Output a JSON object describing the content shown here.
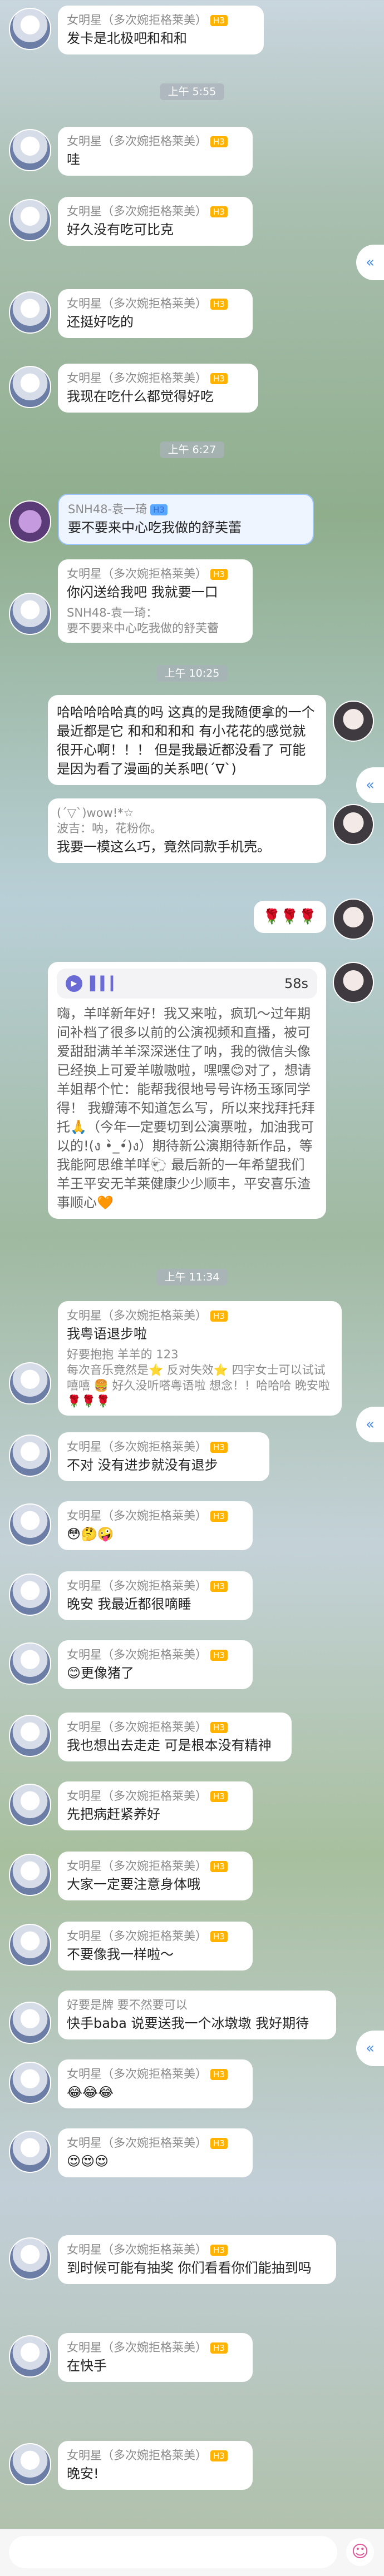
{
  "name_main": "女明星（多次婉拒格莱美）",
  "tag_main": "H3",
  "name_snh": "SNH48-袁一琦",
  "tag_snh": "H3",
  "collapse_glyph": "«",
  "times": [
    "上午 5:55",
    "上午 6:27",
    "上午 10:25",
    "上午 11:34"
  ],
  "messages": {
    "m1": "发卡是北极吧和和和",
    "m2": "哇",
    "m3": "好久没有吃可比克",
    "m4": "还挺好吃的",
    "m5": "我现在吃什么都觉得好吃",
    "snh_text": "要不要来中心吃我做的舒芙蕾",
    "m6_text": "你闪送给我吧 我就要一口",
    "m6_quote": "SNH48-袁一琦：\n要不要来中心吃我做的舒芙蕾",
    "self1": "哈哈哈哈哈真的吗 这真的是我随便拿的一个 最近都是它 和和和和和 有小花花的感觉就很开心啊！！！ 但是我最近都没看了 可能是因为看了漫画的关系吧(´∇`)",
    "self2_text": "我要一模这么巧，竟然同款手机壳。",
    "self2_quote": "(´▽`)wow!*☆\n波吉：呐，花粉你。",
    "self3_emoji": "🌹🌹🌹",
    "voice_duration": "58s",
    "self4_text": "嗨，羊咩新年好！我又来啦，疯玑～过年期间补档了很多以前的公演视频和直播，被可爱甜甜满羊羊深深迷住了呐，我的微信头像已经换上可爱羊嗷嗷啦，嘿嘿😊对了，想请羊姐帮个忙：能帮我很地号号许杨玉琢同学得！ 我瓣薄不知道怎么写，所以来找拜托拜托🙏（今年一定要切到公演票啦，加油我可以的!(ง •̀_•́)ง）期待新公演期待新作品，等我能阿思维羊咩🐑 最后新的一年希望我们羊王平安无羊莱健康少少顺丰，平安喜乐渣事顺心🧡",
    "m7_text": "我粤语退步啦",
    "m7_quote": "好要抱抱 羊羊的 123\n每次音乐竟然是⭐️ 反对失效⭐️ 四字女士可以试试嘻嘻 🍔 好久没听嗒粤语啦 想念！！哈哈哈 晚安啦🌹🌹🌹",
    "m8": "不对 没有进步就没有退步",
    "m9": "😳🤔🤪",
    "m10": "晚安 我最近都很嘀睡",
    "m11": "😊更像猪了",
    "m12": "我也想出去走走 可是根本没有精神",
    "m13": "先把病赶紧养好",
    "m14": "大家一定要注意身体哦",
    "m15": "不要像我一样啦～",
    "m16_text": "快手baba 说要送我一个冰墩墩 我好期待",
    "m16_quote": "好要是牌 要不然要可以",
    "m17": "😂😂😂",
    "m18": "😍😍😍",
    "m19": "到时候可能有抽奖 你们看看你们能抽到吗",
    "m20": "在快手",
    "m21": "晚安!"
  },
  "input": {
    "placeholder": "",
    "value": ""
  },
  "emoji_glyph": "☺"
}
